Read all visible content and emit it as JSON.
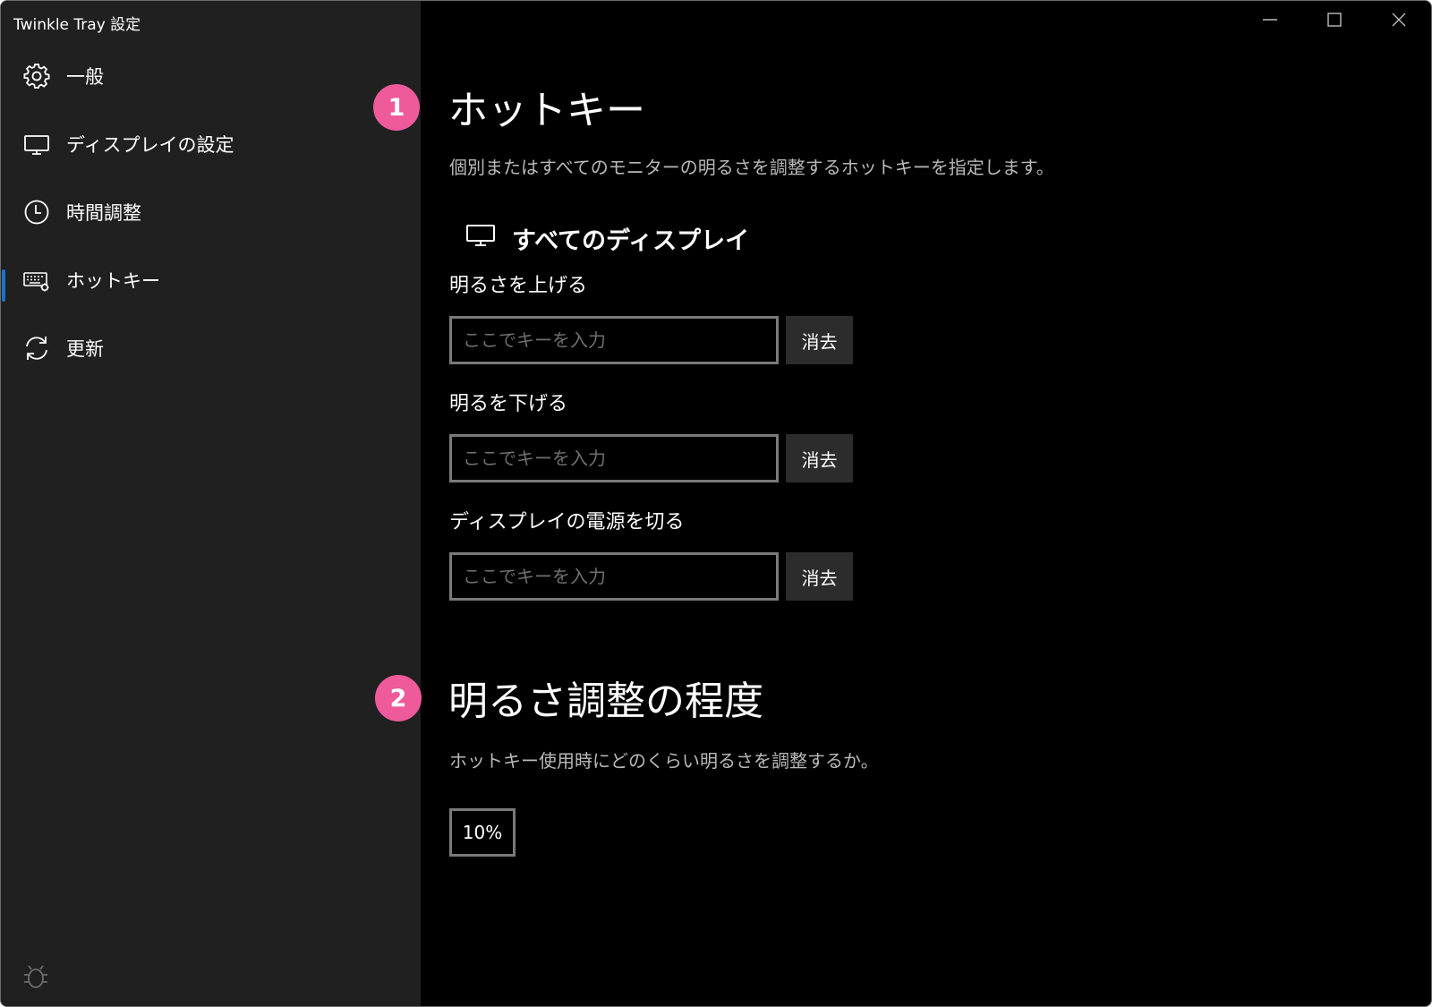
{
  "window": {
    "title": "Twinkle Tray 設定",
    "minimize_icon": "minimize-icon",
    "maximize_icon": "maximize-icon",
    "close_icon": "close-icon"
  },
  "sidebar": {
    "items": [
      {
        "label": "一般",
        "icon": "gear-icon"
      },
      {
        "label": "ディスプレイの設定",
        "icon": "monitor-icon"
      },
      {
        "label": "時間調整",
        "icon": "clock-icon"
      },
      {
        "label": "ホットキー",
        "icon": "keyboard-gear-icon",
        "active": true
      },
      {
        "label": "更新",
        "icon": "refresh-icon"
      }
    ],
    "footer_icon": "bug-icon"
  },
  "hotkeys": {
    "badge": "1",
    "title": "ホットキー",
    "description": "個別またはすべてのモニターの明るさを調整するホットキーを指定します。",
    "group_title": "すべてのディスプレイ",
    "fields": [
      {
        "label": "明るさを上げる",
        "placeholder": "ここでキーを入力",
        "clear_label": "消去"
      },
      {
        "label": "明るを下げる",
        "placeholder": "ここでキーを入力",
        "clear_label": "消去"
      },
      {
        "label": "ディスプレイの電源を切る",
        "placeholder": "ここでキーを入力",
        "clear_label": "消去"
      }
    ]
  },
  "step": {
    "badge": "2",
    "title": "明るさ調整の程度",
    "description": "ホットキー使用時にどのくらい明るさを調整するか。",
    "value": "10%"
  },
  "colors": {
    "sidebar_bg": "#202020",
    "content_bg": "#000000",
    "accent": "#1a73c8",
    "badge": "#ee5a9a"
  }
}
